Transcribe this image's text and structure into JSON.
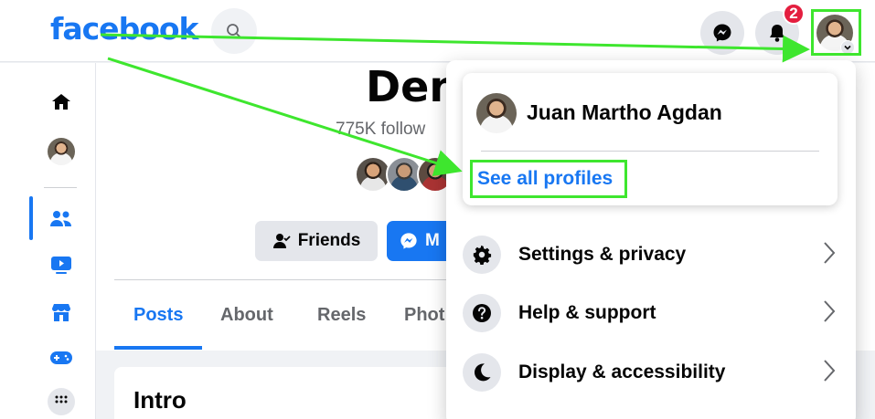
{
  "topbar": {
    "logo": "facebook",
    "notification_count": "2"
  },
  "profile": {
    "name_partial": "Den",
    "followers_partial": "775K follow",
    "friends_label": "Friends",
    "message_label_partial": "M"
  },
  "tabs": [
    {
      "label": "Posts",
      "active": true
    },
    {
      "label": "About",
      "active": false
    },
    {
      "label": "Reels",
      "active": false
    },
    {
      "label": "Phot",
      "active": false
    }
  ],
  "intro": {
    "title": "Intro"
  },
  "account_menu": {
    "user_name": "Juan Martho Agdan",
    "see_all_profiles": "See all profiles",
    "items": [
      {
        "label": "Settings & privacy",
        "icon": "gear-icon"
      },
      {
        "label": "Help & support",
        "icon": "question-icon"
      },
      {
        "label": "Display & accessibility",
        "icon": "moon-icon"
      }
    ]
  },
  "colors": {
    "brand": "#1877f2",
    "highlight": "#3ee62e",
    "badge": "#e41e3f"
  }
}
